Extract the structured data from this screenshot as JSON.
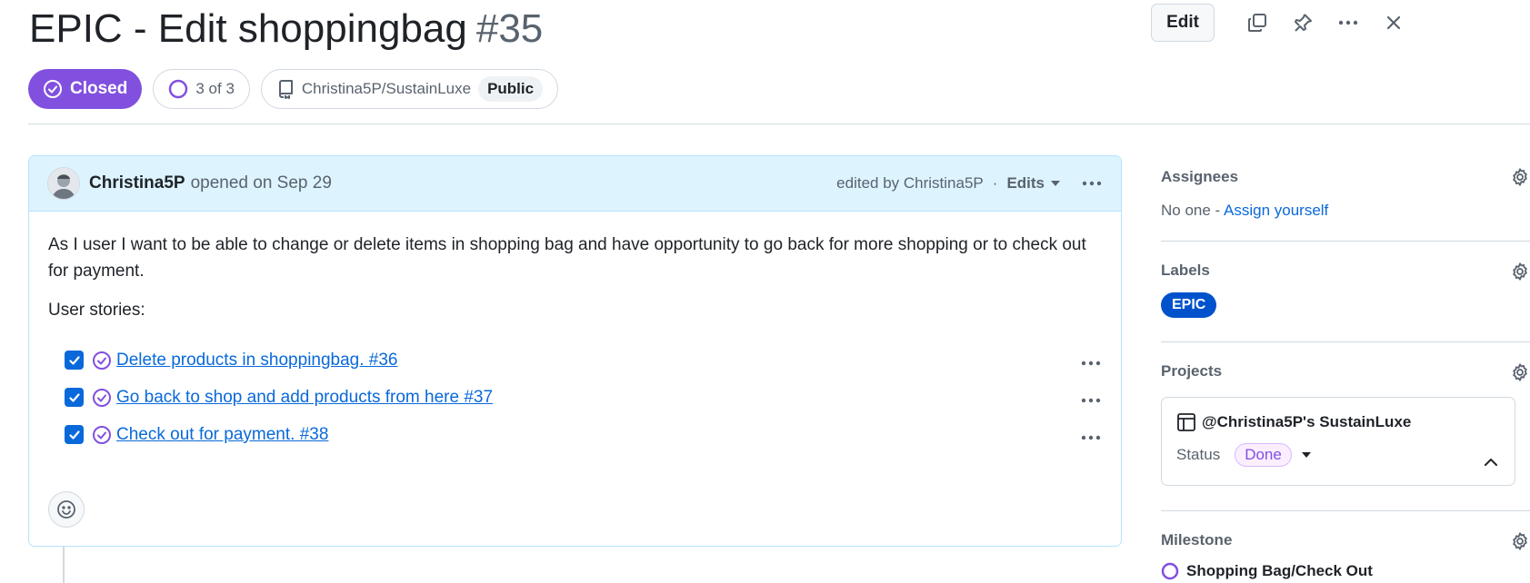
{
  "issue": {
    "title": "EPIC - Edit shoppingbag",
    "number": "#35",
    "state": "Closed",
    "subissues_progress": "3 of 3",
    "repo": "Christina5P/SustainLuxe",
    "visibility": "Public"
  },
  "actions": {
    "edit_label": "Edit",
    "icons": [
      "copy-icon",
      "pin-icon",
      "kebab-icon",
      "close-icon"
    ]
  },
  "comment": {
    "author": "Christina5P",
    "opened_text": "opened on Sep 29",
    "edited_text": "edited by Christina5P",
    "edits_label": "Edits",
    "body_paragraph": "As I user I want to be able to change or delete items in shopping bag and have opportunity to go back for more shopping or to check out for payment.",
    "stories_heading": "User stories:",
    "tasks": [
      {
        "label": "Delete products in shoppingbag. #36",
        "checked": true
      },
      {
        "label": "Go back to shop and add products from here #37",
        "checked": true
      },
      {
        "label": "Check out for payment. #38",
        "checked": true
      }
    ]
  },
  "sidebar": {
    "assignees": {
      "title": "Assignees",
      "empty": "No one - ",
      "assign_link": "Assign yourself"
    },
    "labels": {
      "title": "Labels",
      "items": [
        "EPIC"
      ],
      "label_color": "#0052cc"
    },
    "projects": {
      "title": "Projects",
      "project_name": "@Christina5P's SustainLuxe",
      "status_label": "Status",
      "status_value": "Done"
    },
    "milestone": {
      "title": "Milestone",
      "value_partial": "Shopping Bag/Check Out"
    }
  },
  "colors": {
    "closed_purple": "#8250df",
    "link_blue": "#0969da",
    "comment_header_bg": "#ddf4ff",
    "comment_border": "#b6e3ff"
  }
}
